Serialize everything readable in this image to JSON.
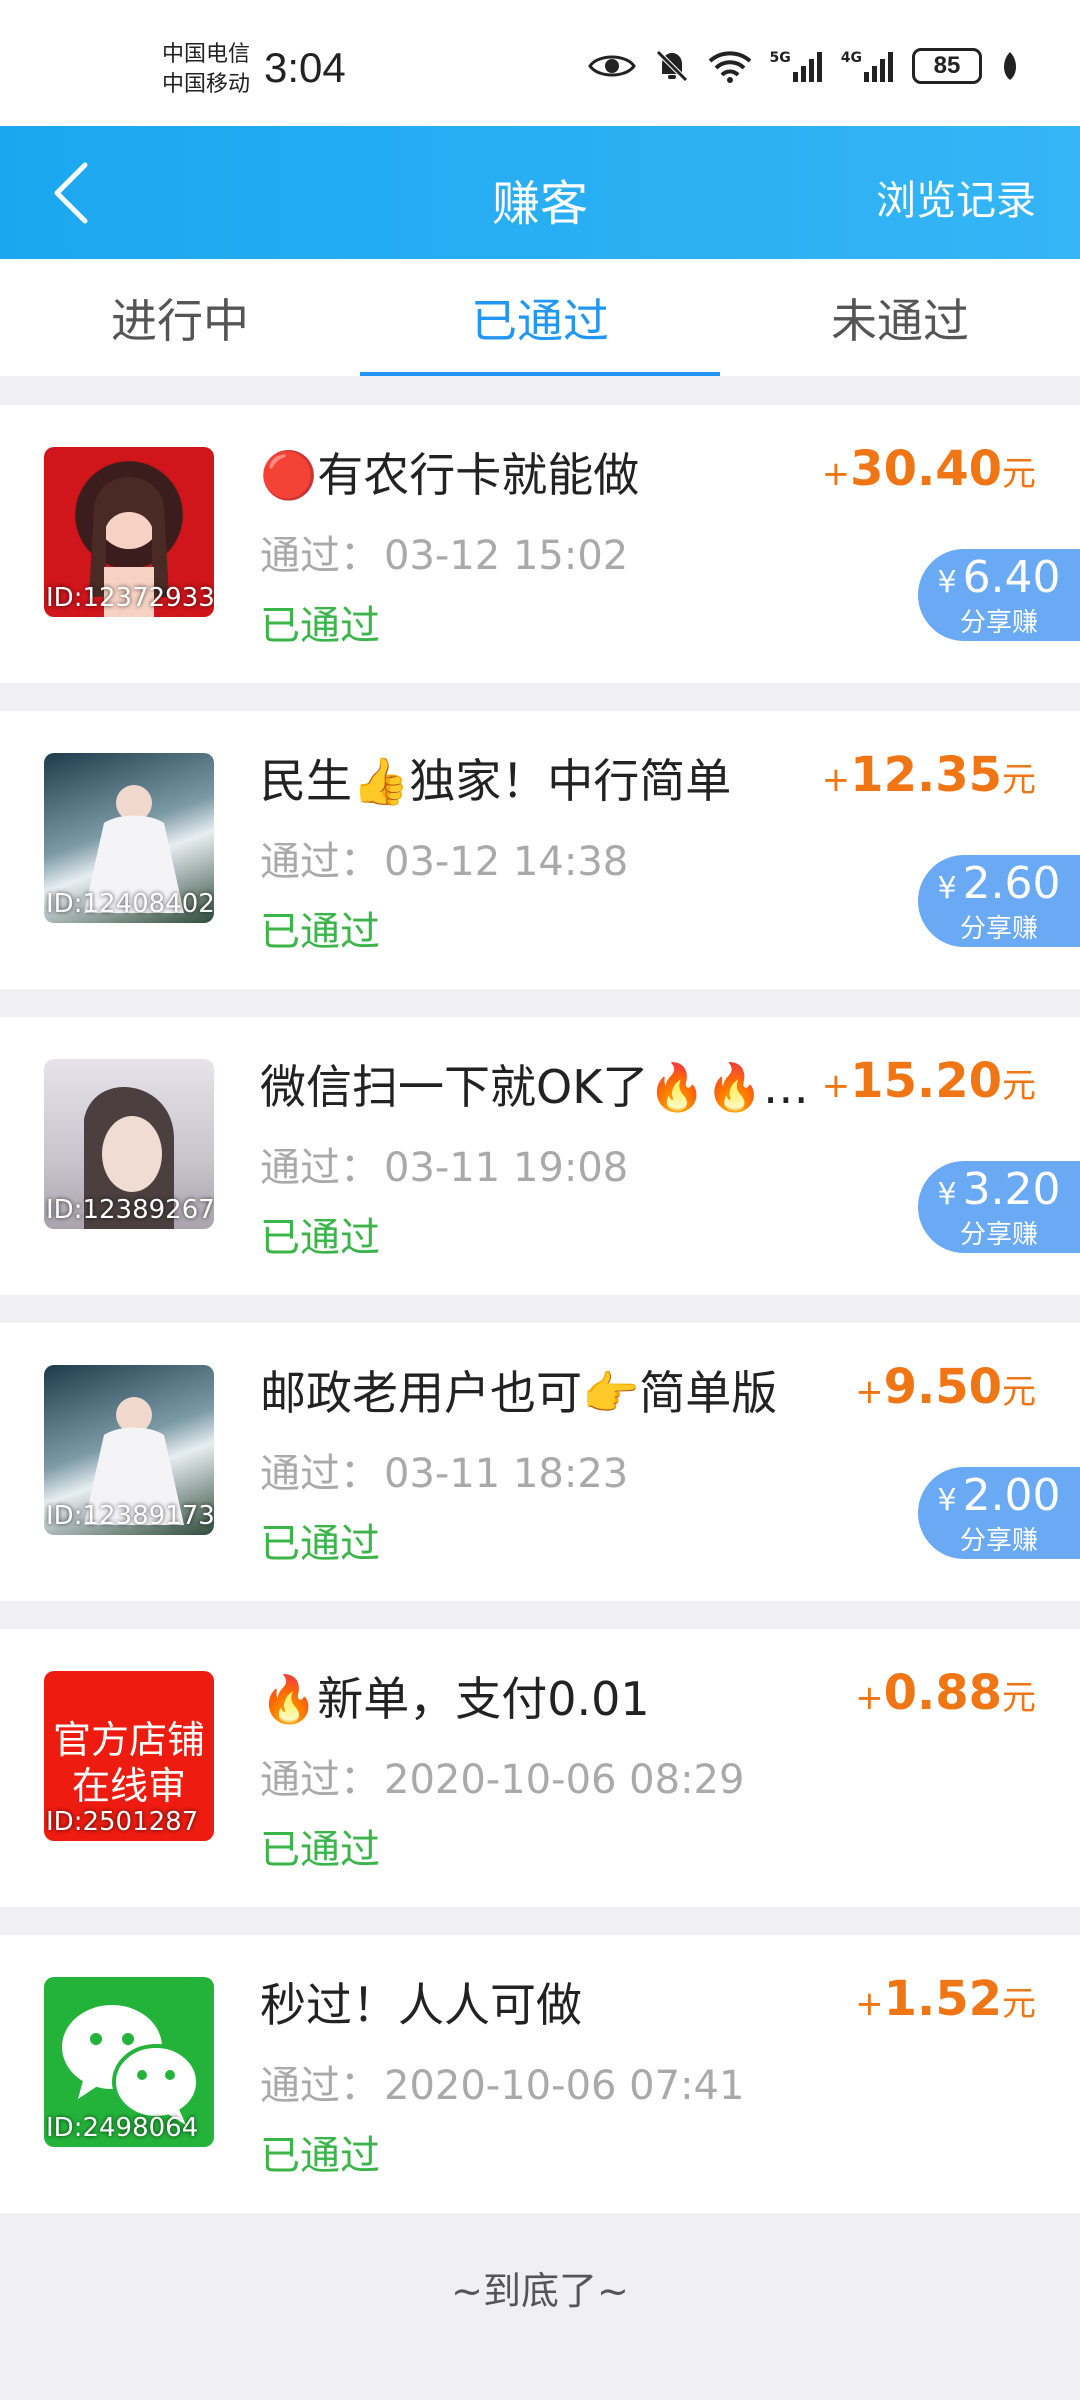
{
  "status_bar": {
    "carrier1": "中国电信",
    "carrier2": "中国移动",
    "time": "3:04",
    "net1": "5G",
    "net2": "4G",
    "battery": "85",
    "icons": [
      "eye-icon",
      "bell-off-icon",
      "wifi-icon",
      "signal-5g-icon",
      "signal-4g-icon",
      "battery-icon",
      "leaf-icon"
    ]
  },
  "header": {
    "title": "赚客",
    "history": "浏览记录"
  },
  "tabs": [
    {
      "label": "进行中"
    },
    {
      "label": "已通过"
    },
    {
      "label": "未通过"
    }
  ],
  "passed_label": "通过：",
  "items": [
    {
      "title": "🔴有农行卡就能做",
      "time": "03-12 15:02",
      "status": "已通过",
      "plus": "+",
      "amount": "30.40",
      "unit": "元",
      "share_yen": "¥",
      "share_amount": "6.40",
      "share_label": "分享赚",
      "id": "ID:12372933"
    },
    {
      "title": "民生👍独家！中行简单",
      "time": "03-12 14:38",
      "status": "已通过",
      "plus": "+",
      "amount": "12.35",
      "unit": "元",
      "share_yen": "¥",
      "share_amount": "2.60",
      "share_label": "分享赚",
      "id": "ID:12408402"
    },
    {
      "title": "微信扫一下就OK了🔥🔥…",
      "time": "03-11 19:08",
      "status": "已通过",
      "plus": "+",
      "amount": "15.20",
      "unit": "元",
      "share_yen": "¥",
      "share_amount": "3.20",
      "share_label": "分享赚",
      "id": "ID:12389267"
    },
    {
      "title": "邮政老用户也可👉简单版",
      "time": "03-11 18:23",
      "status": "已通过",
      "plus": "+",
      "amount": "9.50",
      "unit": "元",
      "share_yen": "¥",
      "share_amount": "2.00",
      "share_label": "分享赚",
      "id": "ID:12389173"
    },
    {
      "title": "🔥新单，支付0.01",
      "time": "2020-10-06 08:29",
      "status": "已通过",
      "plus": "+",
      "amount": "0.88",
      "unit": "元",
      "id": "ID:2501287",
      "avatar_text1": "官方店铺",
      "avatar_text2": "在线审"
    },
    {
      "title": "秒过！人人可做",
      "time": "2020-10-06 07:41",
      "status": "已通过",
      "plus": "+",
      "amount": "1.52",
      "unit": "元",
      "id": "ID:2498064"
    }
  ],
  "footer": {
    "end_text": "~到底了~"
  },
  "colors": {
    "header_blue": "#1ba7ef",
    "active_tab": "#2196f3",
    "reward_orange": "#f07514",
    "status_green": "#3bb44a",
    "share_badge": "#6aa9f3"
  }
}
